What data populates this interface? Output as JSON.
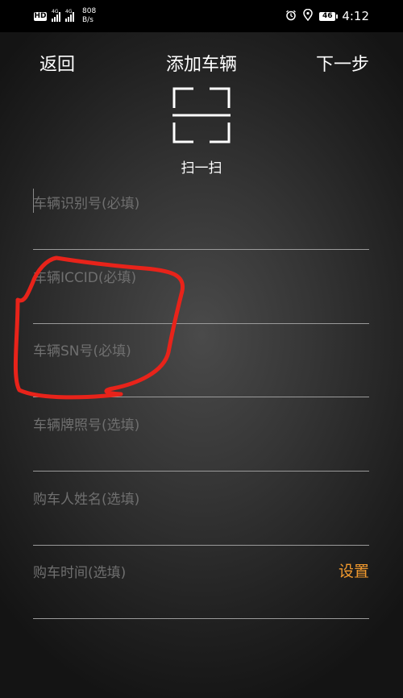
{
  "status_bar": {
    "hd": "HD",
    "sim1_tag": "4G",
    "sim2_tag": "4G",
    "speed_value": "808",
    "speed_unit": "B/s",
    "battery": "46",
    "time": "4:12"
  },
  "nav": {
    "back": "返回",
    "title": "添加车辆",
    "next": "下一步"
  },
  "scan": {
    "label": "扫一扫"
  },
  "fields": [
    {
      "placeholder": "车辆识别号(必填)"
    },
    {
      "placeholder": "车辆ICCID(必填)"
    },
    {
      "placeholder": "车辆SN号(必填)"
    },
    {
      "placeholder": "车辆牌照号(选填)"
    },
    {
      "placeholder": "购车人姓名(选填)"
    },
    {
      "placeholder": "购车时间(选填)",
      "action": "设置"
    }
  ],
  "colors": {
    "accent": "#f29a2e",
    "annotation": "#e8231a"
  }
}
